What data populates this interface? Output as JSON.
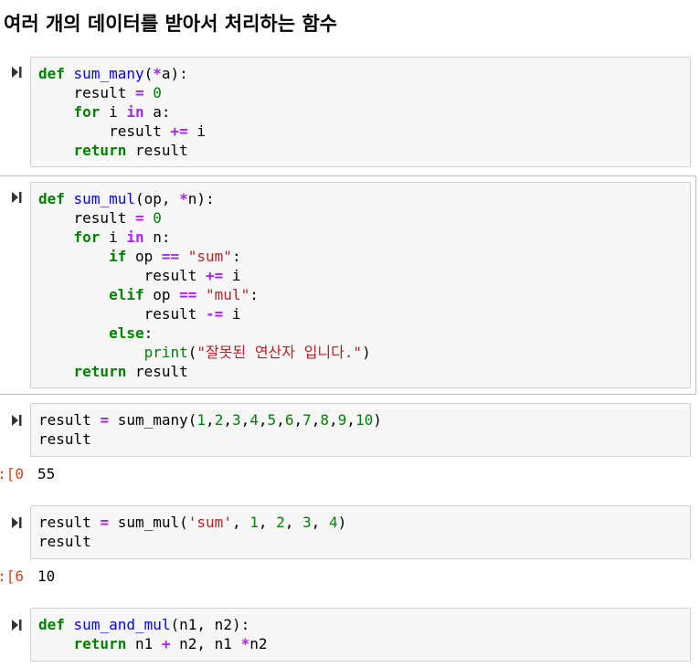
{
  "heading": "여러 개의 데이터를 받아서 처리하는 함수",
  "icons": {
    "run": "run-cell-icon"
  },
  "colors": {
    "keyword": "#008000",
    "function_name": "#0000ff",
    "operator": "#aa22ff",
    "string": "#ba2121",
    "output_prompt": "#d84315",
    "cell_background": "#f7f7f7"
  },
  "cells": [
    {
      "code": [
        [
          [
            "kw",
            "def"
          ],
          [
            "t",
            " "
          ],
          [
            "fn",
            "sum_many"
          ],
          [
            "t",
            "("
          ],
          [
            "op",
            "*"
          ],
          [
            "t",
            "a):"
          ]
        ],
        [
          [
            "t",
            "    result "
          ],
          [
            "op",
            "="
          ],
          [
            "t",
            " "
          ],
          [
            "num",
            "0"
          ]
        ],
        [
          [
            "t",
            "    "
          ],
          [
            "kw",
            "for"
          ],
          [
            "t",
            " i "
          ],
          [
            "op",
            "in"
          ],
          [
            "t",
            " a:"
          ]
        ],
        [
          [
            "t",
            "        result "
          ],
          [
            "op",
            "+="
          ],
          [
            "t",
            " i"
          ]
        ],
        [
          [
            "t",
            "    "
          ],
          [
            "kw",
            "return"
          ],
          [
            "t",
            " result"
          ]
        ]
      ]
    },
    {
      "code": [
        [
          [
            "kw",
            "def"
          ],
          [
            "t",
            " "
          ],
          [
            "fn",
            "sum_mul"
          ],
          [
            "t",
            "(op, "
          ],
          [
            "op",
            "*"
          ],
          [
            "t",
            "n):"
          ]
        ],
        [
          [
            "t",
            "    result "
          ],
          [
            "op",
            "="
          ],
          [
            "t",
            " "
          ],
          [
            "num",
            "0"
          ]
        ],
        [
          [
            "t",
            "    "
          ],
          [
            "kw",
            "for"
          ],
          [
            "t",
            " i "
          ],
          [
            "op",
            "in"
          ],
          [
            "t",
            " n:"
          ]
        ],
        [
          [
            "t",
            "        "
          ],
          [
            "kw",
            "if"
          ],
          [
            "t",
            " op "
          ],
          [
            "op",
            "=="
          ],
          [
            "t",
            " "
          ],
          [
            "str",
            "\"sum\""
          ],
          [
            "t",
            ":"
          ]
        ],
        [
          [
            "t",
            "            result "
          ],
          [
            "op",
            "+="
          ],
          [
            "t",
            " i"
          ]
        ],
        [
          [
            "t",
            "        "
          ],
          [
            "kw",
            "elif"
          ],
          [
            "t",
            " op "
          ],
          [
            "op",
            "=="
          ],
          [
            "t",
            " "
          ],
          [
            "str",
            "\"mul\""
          ],
          [
            "t",
            ":"
          ]
        ],
        [
          [
            "t",
            "            result "
          ],
          [
            "op",
            "-="
          ],
          [
            "t",
            " i"
          ]
        ],
        [
          [
            "t",
            "        "
          ],
          [
            "kw",
            "else"
          ],
          [
            "t",
            ":"
          ]
        ],
        [
          [
            "t",
            "            "
          ],
          [
            "bi",
            "print"
          ],
          [
            "t",
            "("
          ],
          [
            "str",
            "\"잘못된 연산자 입니다.\""
          ],
          [
            "t",
            ")"
          ]
        ],
        [
          [
            "t",
            "    "
          ],
          [
            "kw",
            "return"
          ],
          [
            "t",
            " result"
          ]
        ]
      ]
    },
    {
      "code": [
        [
          [
            "t",
            "result "
          ],
          [
            "op",
            "="
          ],
          [
            "t",
            " sum_many("
          ],
          [
            "num",
            "1"
          ],
          [
            "t",
            ","
          ],
          [
            "num",
            "2"
          ],
          [
            "t",
            ","
          ],
          [
            "num",
            "3"
          ],
          [
            "t",
            ","
          ],
          [
            "num",
            "4"
          ],
          [
            "t",
            ","
          ],
          [
            "num",
            "5"
          ],
          [
            "t",
            ","
          ],
          [
            "num",
            "6"
          ],
          [
            "t",
            ","
          ],
          [
            "num",
            "7"
          ],
          [
            "t",
            ","
          ],
          [
            "num",
            "8"
          ],
          [
            "t",
            ","
          ],
          [
            "num",
            "9"
          ],
          [
            "t",
            ","
          ],
          [
            "num",
            "10"
          ],
          [
            "t",
            ")"
          ]
        ],
        [
          [
            "t",
            "result"
          ]
        ]
      ],
      "output_prompt": "0]:",
      "output": "55"
    },
    {
      "code": [
        [
          [
            "t",
            "result "
          ],
          [
            "op",
            "="
          ],
          [
            "t",
            " sum_mul("
          ],
          [
            "str",
            "'sum'"
          ],
          [
            "t",
            ", "
          ],
          [
            "num",
            "1"
          ],
          [
            "t",
            ", "
          ],
          [
            "num",
            "2"
          ],
          [
            "t",
            ", "
          ],
          [
            "num",
            "3"
          ],
          [
            "t",
            ", "
          ],
          [
            "num",
            "4"
          ],
          [
            "t",
            ")"
          ]
        ],
        [
          [
            "t",
            "result"
          ]
        ]
      ],
      "output_prompt": "6]:",
      "output": "10"
    },
    {
      "code": [
        [
          [
            "kw",
            "def"
          ],
          [
            "t",
            " "
          ],
          [
            "fn",
            "sum_and_mul"
          ],
          [
            "t",
            "(n1, n2):"
          ]
        ],
        [
          [
            "t",
            "    "
          ],
          [
            "kw",
            "return"
          ],
          [
            "t",
            " n1 "
          ],
          [
            "op",
            "+"
          ],
          [
            "t",
            " n2, n1 "
          ],
          [
            "op",
            "*"
          ],
          [
            "t",
            "n2"
          ]
        ]
      ]
    }
  ]
}
